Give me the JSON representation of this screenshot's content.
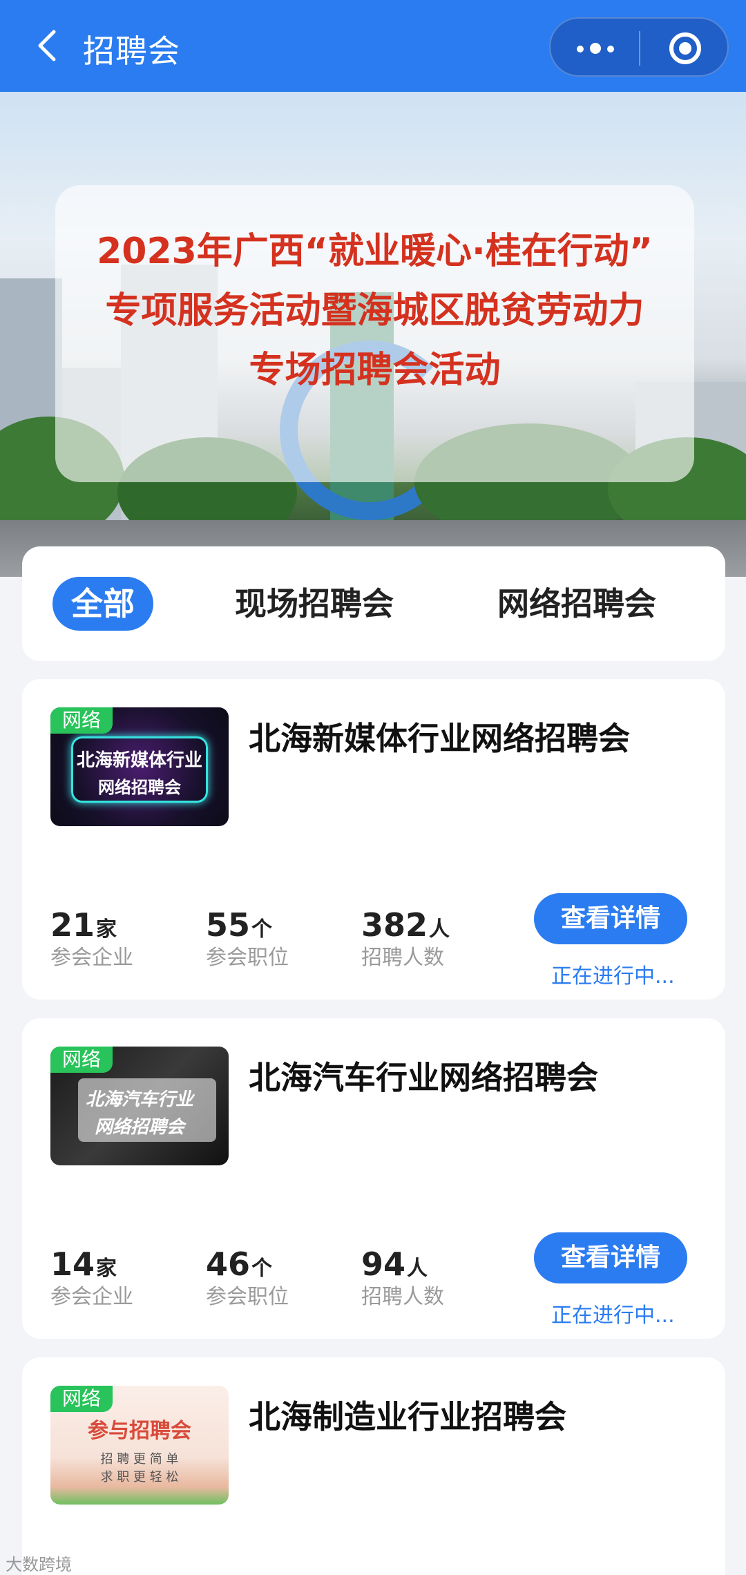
{
  "header": {
    "title": "招聘会",
    "back_icon": "chevron-left-icon",
    "more_icon": "more-dots-icon",
    "close_icon": "target-circle-icon",
    "color": "#2b7cf0"
  },
  "banner": {
    "lines": [
      "2023年广西“就业暖心·桂在行动”",
      "专项服务活动暨海城区脱贫劳动力",
      "专场招聘会活动"
    ],
    "text_color": "#d4311f"
  },
  "tabs": [
    {
      "label": "全部",
      "active": true
    },
    {
      "label": "现场招聘会",
      "active": false
    },
    {
      "label": "网络招聘会",
      "active": false
    }
  ],
  "fairs": [
    {
      "tag": "网络",
      "thumb_lines": [
        "北海新媒体行业",
        "网络招聘会"
      ],
      "title": "北海新媒体行业网络招聘会",
      "companies": "21",
      "companies_unit": "家",
      "companies_label": "参会企业",
      "positions": "55",
      "positions_unit": "个",
      "positions_label": "参会职位",
      "hires": "382",
      "hires_unit": "人",
      "hires_label": "招聘人数",
      "button": "查看详情",
      "status": "正在进行中..."
    },
    {
      "tag": "网络",
      "thumb_lines": [
        "北海汽车行业",
        "网络招聘会"
      ],
      "title": "北海汽车行业网络招聘会",
      "companies": "14",
      "companies_unit": "家",
      "companies_label": "参会企业",
      "positions": "46",
      "positions_unit": "个",
      "positions_label": "参会职位",
      "hires": "94",
      "hires_unit": "人",
      "hires_label": "招聘人数",
      "button": "查看详情",
      "status": "正在进行中..."
    },
    {
      "tag": "网络",
      "thumb_lines": [
        "参与招聘会",
        "招 聘 更 简 单",
        "求 职 更 轻 松"
      ],
      "title": "北海制造业行业招聘会"
    }
  ],
  "watermark": "大数跨境"
}
